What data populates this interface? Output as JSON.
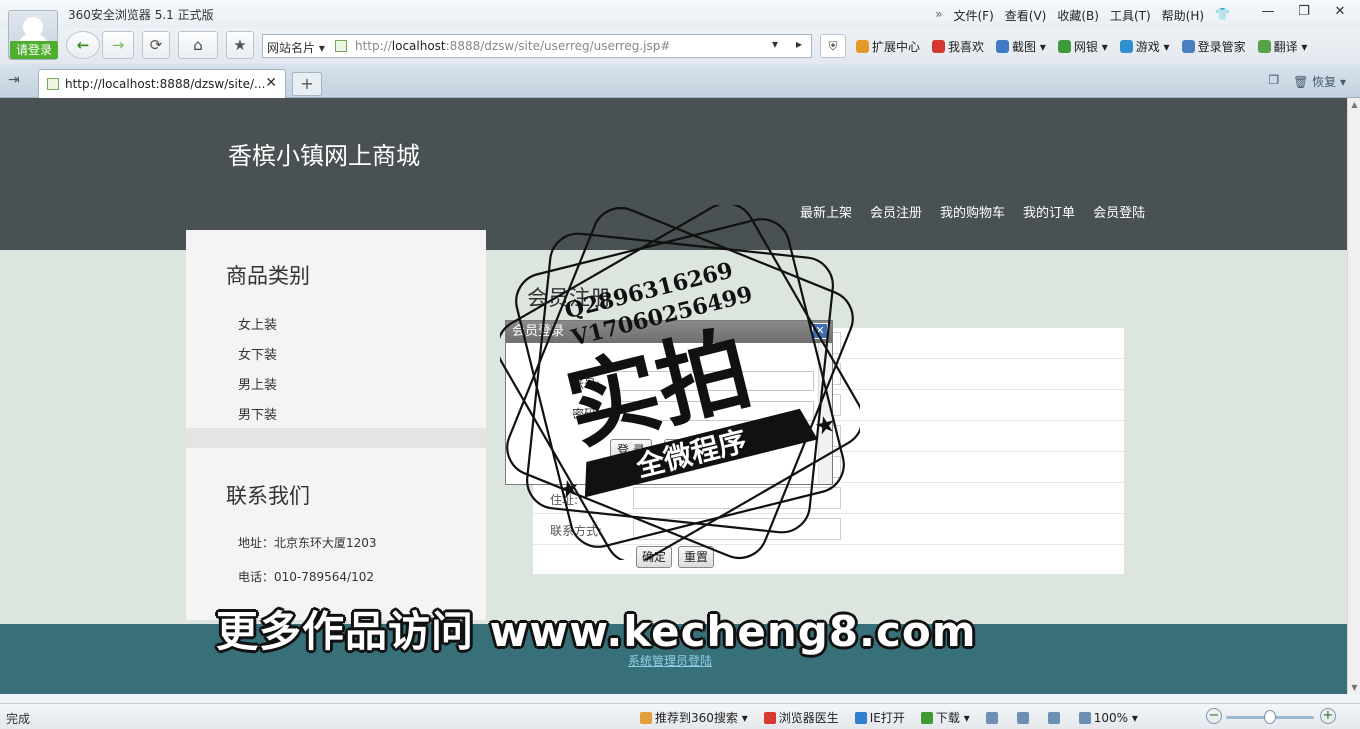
{
  "browser": {
    "login_label": "请登录",
    "app_title": "360安全浏览器 5.1 正式版",
    "menu": [
      "文件(F)",
      "查看(V)",
      "收藏(B)",
      "工具(T)",
      "帮助(H)"
    ],
    "window_controls": {
      "min": "—",
      "restore": "❐",
      "close": "✕"
    },
    "toolbar": {
      "back": "←",
      "forward": "→",
      "refresh": "⟳",
      "home": "⌂",
      "favorite": "★",
      "site_name": "网站名片 ▾",
      "url_prefix": "http://",
      "url_host": "localhost",
      "url_rest": ":8888/dzsw/site/userreg/userreg.jsp#",
      "url_dropdown": "▾",
      "url_go": "▸",
      "shield": "⛨"
    },
    "extensions": [
      {
        "label": "扩展中心",
        "icon": "puzzle-icon",
        "color": "#e49a2a"
      },
      {
        "label": "我喜欢",
        "icon": "heart-icon",
        "color": "#d4372f"
      },
      {
        "label": "截图 ▾",
        "icon": "scissors-icon",
        "color": "#3e7bc4"
      },
      {
        "label": "网银 ▾",
        "icon": "bank-icon",
        "color": "#3c9a3b"
      },
      {
        "label": "游戏 ▾",
        "icon": "gamepad-icon",
        "color": "#2f8fd1"
      },
      {
        "label": "登录管家",
        "icon": "key-icon",
        "color": "#4a7fc0"
      },
      {
        "label": "翻译 ▾",
        "icon": "translate-icon",
        "color": "#5aa14b"
      }
    ],
    "tab_title": "http://localhost:8888/dzsw/site/...",
    "tab_close": "✕",
    "new_tab": "+",
    "restore_label": "恢复 ▾",
    "status": "完成",
    "status_items": [
      {
        "label": "推荐到360搜索 ▾",
        "color": "#e2a03a"
      },
      {
        "label": "浏览器医生",
        "color": "#d63a2f"
      },
      {
        "label": "IE打开",
        "color": "#2f7ed0"
      },
      {
        "label": "下载 ▾",
        "color": "#3e9b2f"
      },
      {
        "label": "",
        "color": "#6d8fb3"
      },
      {
        "label": "",
        "color": "#6d8fb3"
      },
      {
        "label": "",
        "color": "#6d8fb3"
      },
      {
        "label": "100% ▾",
        "color": "#6d8fb3"
      }
    ],
    "zoom": {
      "minus": "−",
      "plus": "+",
      "level": 0.5
    }
  },
  "site": {
    "shop_title": "香槟小镇网上商城",
    "nav": [
      "最新上架",
      "会员注册",
      "我的购物车",
      "我的订单",
      "会员登陆"
    ],
    "categories_heading": "商品类别",
    "categories": [
      "女上装",
      "女下装",
      "男上装",
      "男下装"
    ],
    "contact_heading": "联系我们",
    "contact": [
      "地址：北京东环大厦1203",
      "电话：010-789564/102"
    ],
    "register_heading": "会员注册",
    "form_rows": [
      "",
      "",
      "",
      "",
      "",
      "住址:",
      "联系方式:"
    ],
    "confirm_btn": "确定",
    "reset_btn": "重置",
    "admin_link": "系统管理员登陆"
  },
  "dialog": {
    "title": "会员登录",
    "close": "✕",
    "account_label": "账号:",
    "password_label": "密码:",
    "login_btn": "登 录",
    "reset_btn": "重置"
  },
  "overlay": {
    "qq": "Q2896316269",
    "wechat": "V17060256499",
    "stamp_big": "实拍",
    "stamp_banner": "全微程序",
    "watermark": "更多作品访问 www.kecheng8.com"
  },
  "colors": {
    "hero": "#4a5153",
    "page_bg": "#dde6de",
    "footer": "#38707a",
    "accent_green": "#4fae2e"
  }
}
